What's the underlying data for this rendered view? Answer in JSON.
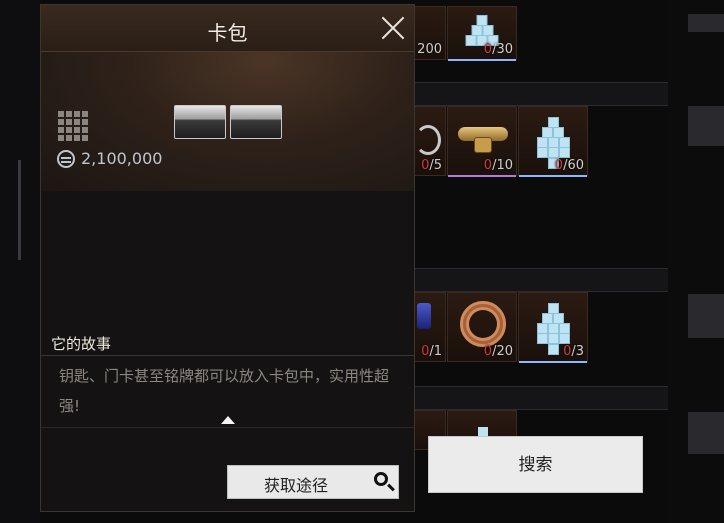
{
  "card": {
    "title": "卡包",
    "price": "2,100,000",
    "story_title": "它的故事",
    "story_text": "钥匙、门卡甚至铭牌都可以放入卡包中，实用性超强!",
    "source_button": "获取途径"
  },
  "search_button": "搜索",
  "background_slots": [
    {
      "have": "",
      "need": "200",
      "icon": "unknown"
    },
    {
      "have": "0",
      "need": "/30",
      "icon": "blue-cubes-icon"
    },
    {
      "have": "0",
      "need": "/5",
      "icon": "ring-icon"
    },
    {
      "have": "0",
      "need": "/10",
      "icon": "watch-icon"
    },
    {
      "have": "0",
      "need": "/60",
      "icon": "blue-cubes-icon"
    },
    {
      "have": "0",
      "need": "/1",
      "icon": "gem-icon"
    },
    {
      "have": "0",
      "need": "/20",
      "icon": "copper-wire-icon"
    },
    {
      "have": "0",
      "need": "/3",
      "icon": "blue-cubes-icon"
    }
  ],
  "colors": {
    "shortfall": "#d13a3a",
    "accent": "#5b4636"
  }
}
